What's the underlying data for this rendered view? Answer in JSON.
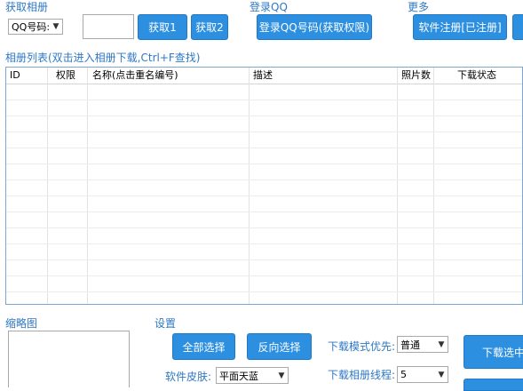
{
  "get_album": {
    "title": "获取相册",
    "qq_type_select": "QQ号码:",
    "qq_input_value": "",
    "get1_label": "获取1",
    "get2_label": "获取2"
  },
  "login": {
    "title": "登录QQ",
    "login_button": "登录QQ号码(获取权限)"
  },
  "more": {
    "title": "更多",
    "register_button": "软件注册[已注册]"
  },
  "album_list": {
    "title": "相册列表(双击进入相册下载,Ctrl+F查找)",
    "columns": [
      "ID",
      "权限",
      "名称(点击重名编号)",
      "描述",
      "照片数",
      "下载状态"
    ],
    "rows": []
  },
  "thumbnail": {
    "title": "缩略图"
  },
  "settings": {
    "title": "设置",
    "select_all_button": "全部选择",
    "invert_select_button": "反向选择",
    "skin_label": "软件皮肤:",
    "skin_value": "平面天蓝",
    "download_mode_label": "下载模式优先:",
    "download_mode_value": "普通",
    "threads_label": "下载相册线程:",
    "threads_value": "5",
    "download_selected_button": "下载选中"
  },
  "colors": {
    "accent": "#2d8fe0",
    "section_title": "#2f78c4",
    "grid_border": "#7fa6cf"
  }
}
